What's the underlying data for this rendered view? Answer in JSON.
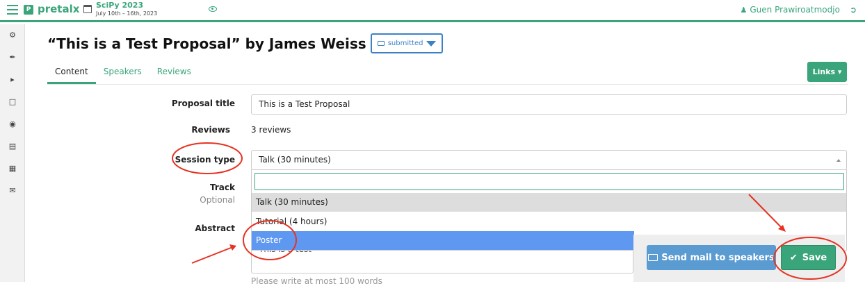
{
  "topbar": {
    "brand": "pretalx",
    "event_name": "SciPy 2023",
    "event_dates": "July 10th – 16th, 2023",
    "user_name": "Guen Prawiroatmodjo"
  },
  "page": {
    "title": "“This is a Test Proposal” by James Weiss",
    "state": "submitted"
  },
  "tabs": [
    {
      "label": "Content"
    },
    {
      "label": "Speakers"
    },
    {
      "label": "Reviews"
    }
  ],
  "links_button": "Links ▾",
  "form": {
    "proposal_title_label": "Proposal title",
    "proposal_title_value": "This is a Test Proposal",
    "reviews_label": "Reviews",
    "reviews_value": "3 reviews",
    "session_type_label": "Session type",
    "session_type_value": "Talk (30 minutes)",
    "track_label": "Track",
    "track_optional": "Optional",
    "abstract_label": "Abstract",
    "abstract_value": "This is a test",
    "abstract_help": "Please write at most 100 words"
  },
  "dropdown": {
    "search_value": "",
    "options": [
      {
        "label": "Talk (30 minutes)",
        "state": "hover"
      },
      {
        "label": "Tutorial (4 hours)",
        "state": "normal"
      },
      {
        "label": "Poster",
        "state": "selected"
      }
    ]
  },
  "actions": {
    "send_mail": "Send mail to speakers",
    "save": "Save"
  },
  "colors": {
    "brand": "#3aa57a",
    "state_blue": "#3b82c4",
    "selected_option": "#5e98f0",
    "annotation": "#e63222"
  },
  "sidebar_icons": [
    "dashboard-icon",
    "wrench-icon",
    "megaphone-icon",
    "sticky-note-icon",
    "eye-icon",
    "id-card-icon",
    "calendar-icon",
    "envelope-icon"
  ]
}
